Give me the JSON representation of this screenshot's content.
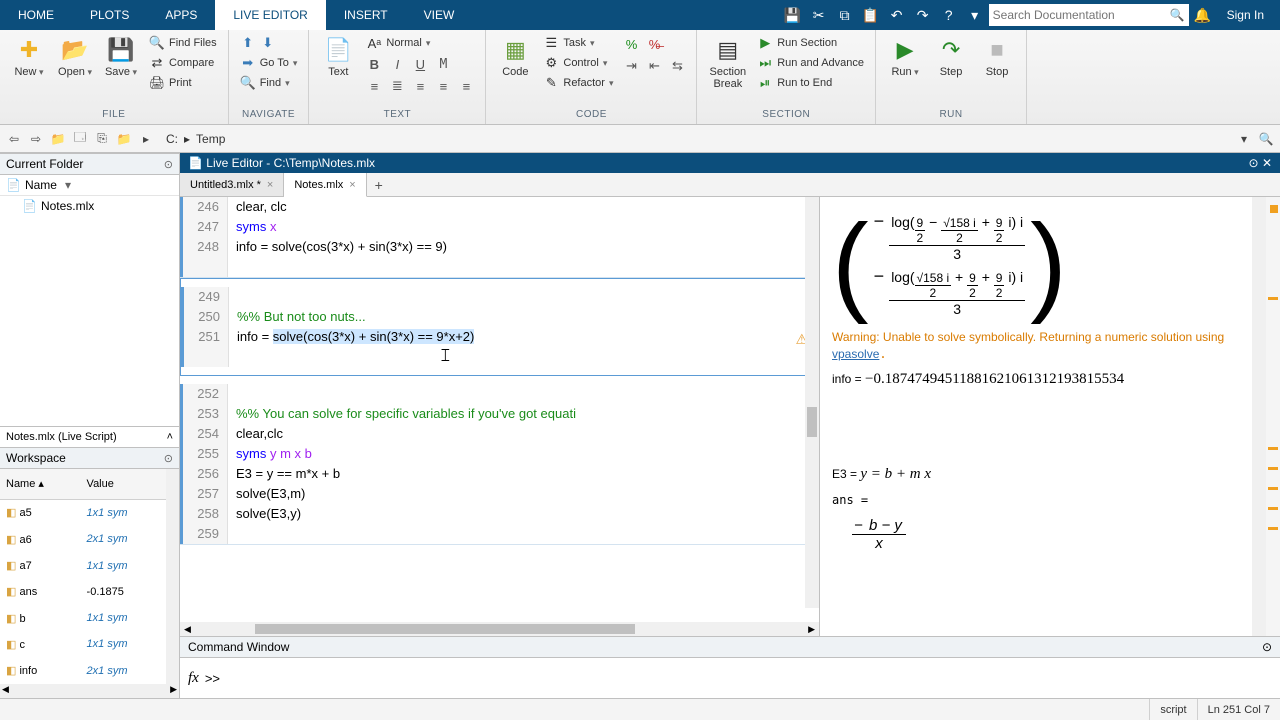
{
  "tabs": {
    "home": "HOME",
    "plots": "PLOTS",
    "apps": "APPS",
    "live": "LIVE EDITOR",
    "insert": "INSERT",
    "view": "VIEW"
  },
  "search": {
    "placeholder": "Search Documentation"
  },
  "signin": "Sign In",
  "ribbon": {
    "file": {
      "label": "FILE",
      "new": "New",
      "open": "Open",
      "save": "Save",
      "findfiles": "Find Files",
      "compare": "Compare",
      "print": "Print"
    },
    "navigate": {
      "label": "NAVIGATE",
      "goto": "Go To",
      "find": "Find"
    },
    "text": {
      "label": "TEXT",
      "btn": "Text",
      "normal": "Normal"
    },
    "code": {
      "label": "CODE",
      "btn": "Code",
      "task": "Task",
      "control": "Control",
      "refactor": "Refactor"
    },
    "section": {
      "label": "SECTION",
      "btn": "Section\nBreak",
      "run": "Run Section",
      "adv": "Run and Advance",
      "end": "Run to End"
    },
    "run": {
      "label": "RUN",
      "run": "Run",
      "step": "Step",
      "stop": "Stop"
    }
  },
  "addr": {
    "drive": "C:",
    "folder": "Temp"
  },
  "currentFolder": {
    "title": "Current Folder",
    "nameHdr": "Name",
    "file": "Notes.mlx",
    "scriptInfo": "Notes.mlx  (Live Script)"
  },
  "workspace": {
    "title": "Workspace",
    "nameHdr": "Name",
    "valHdr": "Value",
    "vars": [
      {
        "n": "a5",
        "v": "1x1 sym",
        "i": true
      },
      {
        "n": "a6",
        "v": "2x1 sym",
        "i": true
      },
      {
        "n": "a7",
        "v": "1x1 sym",
        "i": true
      },
      {
        "n": "ans",
        "v": "-0.1875",
        "i": false
      },
      {
        "n": "b",
        "v": "1x1 sym",
        "i": true
      },
      {
        "n": "c",
        "v": "1x1 sym",
        "i": true
      },
      {
        "n": "info",
        "v": "2x1 sym",
        "i": true
      }
    ]
  },
  "editor": {
    "title": "Live Editor - C:\\Temp\\Notes.mlx",
    "tabs": [
      {
        "label": "Untitled3.mlx *"
      },
      {
        "label": "Notes.mlx"
      }
    ],
    "lines": {
      "l246": "clear, clc",
      "l247a": "syms ",
      "l247b": "x",
      "l248": "info = solve(cos(3*x) + sin(3*x) == 9)",
      "l250": "%% But not too nuts...",
      "l251a": "info = ",
      "l251b": "solve(cos(3*x) + sin(3*x) == 9*x+2)",
      "l253": "%% You can solve for specific variables if you've got equati",
      "l254": "clear,clc",
      "l255a": "syms ",
      "l255b": "y m x b",
      "l256": "E3 = y == m*x + b",
      "l257": "solve(E3,m)",
      "l258": "solve(E3,y)"
    },
    "lineNums": {
      "246": "246",
      "247": "247",
      "248": "248",
      "249": "249",
      "250": "250",
      "251": "251",
      "252": "252",
      "253": "253",
      "254": "254",
      "255": "255",
      "256": "256",
      "257": "257",
      "258": "258",
      "259": "259"
    }
  },
  "output": {
    "warning": "Warning: Unable to solve symbolically. Returning a numeric solution using ",
    "vpa": "vpasolve",
    "infoLabel": "info = ",
    "infoVal": "−0.18747494511881621061312193815534",
    "e3label": "E3 = ",
    "e3math": "y = b + m x",
    "anslabel": "ans ="
  },
  "cmd": {
    "title": "Command Window",
    "prompt": ">>"
  },
  "status": {
    "mode": "script",
    "pos": "Ln  251  Col  7"
  }
}
